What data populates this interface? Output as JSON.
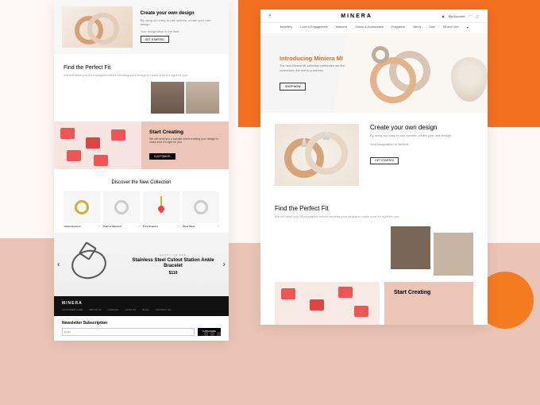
{
  "brand": "MINERA",
  "left": {
    "create": {
      "title": "Create your own design",
      "desc": "By using our easy-to-use options, create your own design.",
      "desc2": "Your imagination is the limit.",
      "btn": "GET STARTED"
    },
    "fit": {
      "title": "Find the Perfect Fit",
      "desc": "We will send you 3D examples before creating your design to make sure it's right for you."
    },
    "start": {
      "title": "Start Creating",
      "desc": "We will send you a sample when creating your design to make sure it's right for you.",
      "btn": "CUSTOMIZE"
    },
    "collection": {
      "title": "Discover the New Collection"
    },
    "products": [
      {
        "name": "Yellow Diamond",
        "class": "prod-gold"
      },
      {
        "name": "Pearl & Diamond",
        "class": ""
      },
      {
        "name": "Pure Seasons",
        "class": "prod-pendant-wrap"
      },
      {
        "name": "Silver Band",
        "class": ""
      }
    ],
    "feature": {
      "tag": "HAPPY TO SEE",
      "title": "Stainless Steel Cutout Station Ankle Bracelet",
      "price": "$110"
    },
    "footerLinks": [
      "CUSTOMER CARE",
      "ABOUT US",
      "CATALOG",
      "CATALOG",
      "BLOG",
      "CONTACT US"
    ],
    "newsletter": {
      "title": "Newsletter Subscription",
      "placeholder": "Email",
      "btn": "SUBSCRIBE"
    }
  },
  "right": {
    "account": "My Account",
    "nav": [
      "Jewellery",
      "Love & Engagement",
      "Watches",
      "Shoes & Accessories",
      "Fragrance",
      "Men's",
      "Sale",
      "Where I Am"
    ],
    "hero": {
      "title": "Introducing Miniera MI",
      "desc": "The new Miniera MI collection celebrates our first connection: the one to ourselves.",
      "btn": "SHOP NOW"
    },
    "create": {
      "title": "Create your own design",
      "desc": "By using our easy-to-use options, create your own design.",
      "desc2": "Your imagination is the limit.",
      "btn": "GET STARTED"
    },
    "fit": {
      "title": "Find the Perfect Fit",
      "desc": "We will send you 3D examples before creating your design to make sure it's right for you."
    },
    "start": {
      "title": "Start Creating"
    }
  }
}
